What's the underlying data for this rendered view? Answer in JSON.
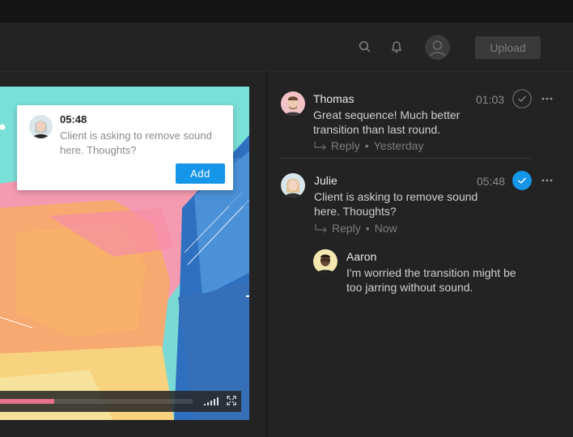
{
  "header": {
    "upload_label": "Upload",
    "icons": [
      "search-icon",
      "bell-icon",
      "user-avatar-icon"
    ]
  },
  "popup": {
    "time": "05:48",
    "text": "Client is asking to remove sound here. Thoughts?",
    "add_label": "Add"
  },
  "video": {
    "progress_fraction": 0.28,
    "accent": "#e7718a"
  },
  "comments": [
    {
      "name": "Thomas",
      "text": "Great sequence! Much better transition than last round.",
      "time": "01:03",
      "reply_label": "Reply",
      "when": "Yesterday",
      "resolved": false
    },
    {
      "name": "Julie",
      "text": "Client is asking to remove sound here. Thoughts?",
      "time": "05:48",
      "reply_label": "Reply",
      "when": "Now",
      "resolved": true
    }
  ],
  "reply": {
    "name": "Aaron",
    "text": "I'm worried the transition might be too jarring without sound."
  },
  "colors": {
    "check_active": "#1596e8",
    "background": "#232323"
  }
}
